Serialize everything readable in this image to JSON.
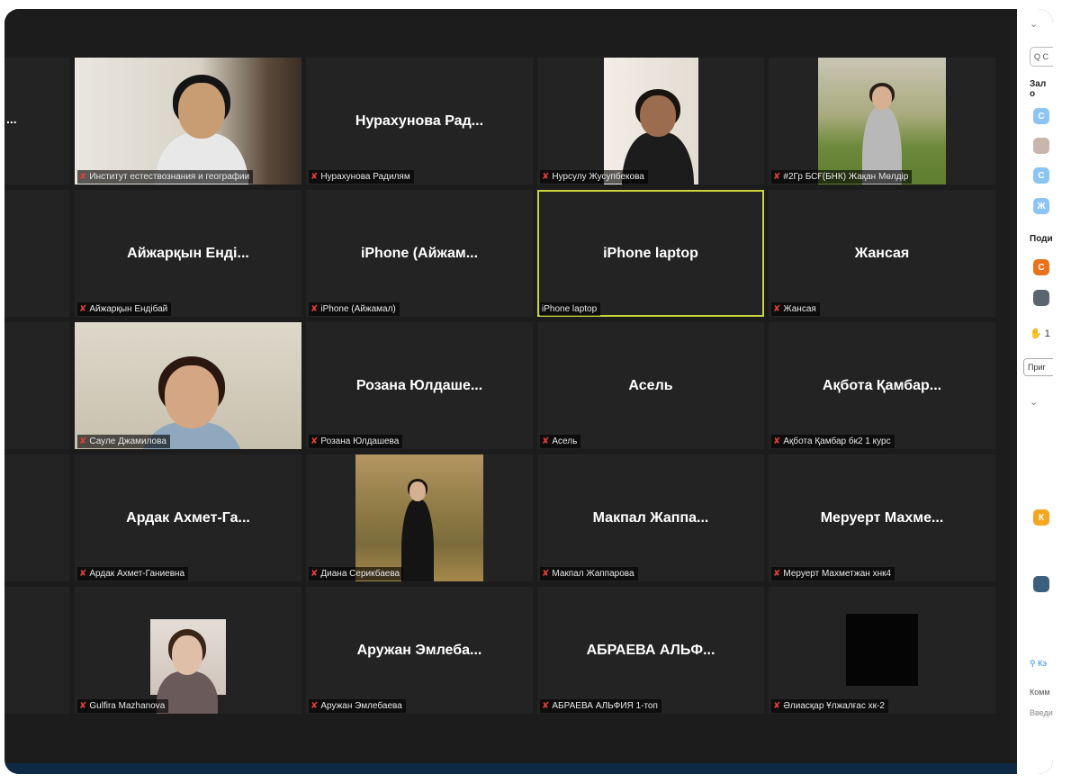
{
  "tiles": [
    {
      "row": 0,
      "col": 0,
      "label": "Институт естествознания и географии",
      "video": "man-young"
    },
    {
      "row": 0,
      "col": 1,
      "name": "Нурахунова  Рад...",
      "label": "Нурахунова Радилям"
    },
    {
      "row": 0,
      "col": 2,
      "label": "Нурсулу Жусупбекова",
      "video": "woman-dark"
    },
    {
      "row": 0,
      "col": 3,
      "label": "#2Гр БСҒ(БНК) Жақан Мөлдір",
      "video": "girl-park"
    },
    {
      "row": 1,
      "col": 0,
      "name": "Айжарқын Енді...",
      "label": "Айжарқын Ендібай"
    },
    {
      "row": 1,
      "col": 1,
      "name": "iPhone  (Айжам...",
      "label": "iPhone (Айжамал)"
    },
    {
      "row": 1,
      "col": 2,
      "name": "iPhone laptop",
      "label": "iPhone laptop",
      "active": true
    },
    {
      "row": 1,
      "col": 3,
      "name": "Жансая",
      "label": "Жансая"
    },
    {
      "row": 2,
      "col": 0,
      "label": "Сауле Джамилова",
      "video": "woman-glasses"
    },
    {
      "row": 2,
      "col": 1,
      "name": "Розана  Юлдаше...",
      "label": "Розана Юлдашева"
    },
    {
      "row": 2,
      "col": 2,
      "name": "Асель",
      "label": "Асель"
    },
    {
      "row": 2,
      "col": 3,
      "name": "Ақбота Қамбар...",
      "label": "Ақбота Қамбар бк2 1 курс"
    },
    {
      "row": 3,
      "col": 0,
      "name": "Ардак  Ахмет-Га...",
      "label": "Ардак Ахмет-Ганиевна"
    },
    {
      "row": 3,
      "col": 1,
      "label": "Диана Серикбаева",
      "video": "girl-autumn"
    },
    {
      "row": 3,
      "col": 2,
      "name": "Макпал  Жаппа...",
      "label": "Макпал Жаппарова"
    },
    {
      "row": 3,
      "col": 3,
      "name": "Меруерт  Махме...",
      "label": "Меруерт Махметжан хнк4"
    },
    {
      "row": 4,
      "col": 0,
      "label": "Gulfira Mazhanova",
      "video": "girl-photo"
    },
    {
      "row": 4,
      "col": 1,
      "name": "Аружан  Эмлеба...",
      "label": "Аружан Эмлебаева"
    },
    {
      "row": 4,
      "col": 2,
      "name": "АБРАЕВА  АЛЬФ...",
      "label": "АБРАЕВА АЛЬФИЯ 1-топ"
    },
    {
      "row": 4,
      "col": 3,
      "label": "Әлиасқар Ұлжалғас хк-2",
      "video": "black"
    }
  ],
  "partial_tile_text": "...",
  "panel": {
    "search_placeholder": "Q С",
    "section_waiting": "Зал о",
    "section_participants": "Поди",
    "raised_hand_count": "1",
    "invite_button": "Приг",
    "more_label": "Кэ",
    "comment_label": "Комм",
    "input_hint": "Введи",
    "avatar_letters": [
      "С",
      "С",
      "Ж",
      "С",
      "К"
    ]
  },
  "colors": {
    "tile_bg": "#232323",
    "active_border": "#c9d33a",
    "muted_mic": "#e0403a",
    "avatar_orange": "#e8731c"
  }
}
